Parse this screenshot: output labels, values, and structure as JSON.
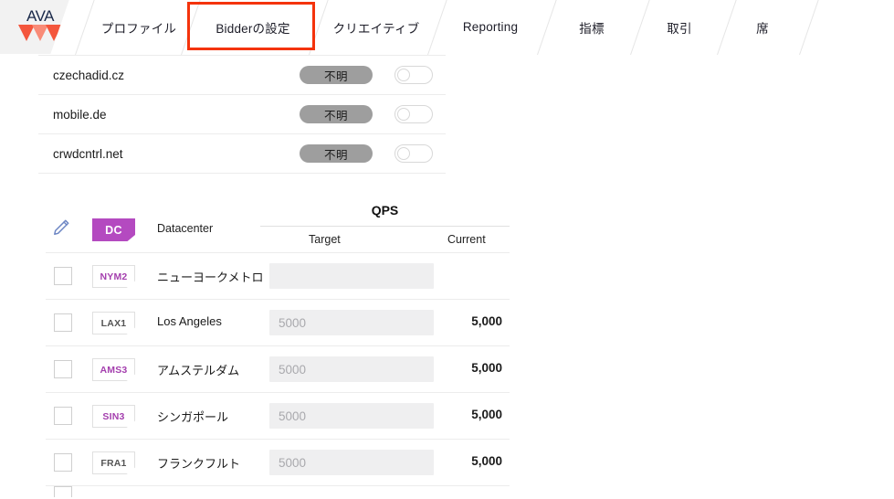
{
  "app": {
    "logo_text": "AVA",
    "logo_icon": "ava-triangles-logo"
  },
  "tabs": [
    {
      "label": "プロファイル",
      "selected": false
    },
    {
      "label": "Bidderの設定",
      "selected": true
    },
    {
      "label": "クリエイティブ",
      "selected": false
    },
    {
      "label": "Reporting",
      "selected": false
    },
    {
      "label": "指標",
      "selected": false
    },
    {
      "label": "取引",
      "selected": false
    },
    {
      "label": "席",
      "selected": false
    }
  ],
  "domain_list": [
    {
      "name": "czechadid.cz",
      "status_badge": "不明",
      "toggle": "off"
    },
    {
      "name": "mobile.de",
      "status_badge": "不明",
      "toggle": "off"
    },
    {
      "name": "crwdcntrl.net",
      "status_badge": "不明",
      "toggle": "off"
    }
  ],
  "qps_table": {
    "edit_icon": "pencil-icon",
    "dc_tag": "DC",
    "datacenter_header": "Datacenter",
    "group_header": "QPS",
    "target_header": "Target",
    "current_header": "Current",
    "rows": [
      {
        "code": "NYM2",
        "name": "ニューヨークメトロ",
        "target_value": "",
        "target_placeholder": "",
        "current": ""
      },
      {
        "code": "LAX1",
        "name": "Los Angeles",
        "target_value": "",
        "target_placeholder": "5000",
        "current": "5,000"
      },
      {
        "code": "AMS3",
        "name": "アムステルダム",
        "target_value": "",
        "target_placeholder": "5000",
        "current": "5,000"
      },
      {
        "code": "SIN3",
        "name": "シンガポール",
        "target_value": "",
        "target_placeholder": "5000",
        "current": "5,000"
      },
      {
        "code": "FRA1",
        "name": "フランクフルト",
        "target_value": "",
        "target_placeholder": "5000",
        "current": "5,000"
      }
    ]
  },
  "annotation": {
    "type": "highlight-rectangle",
    "color": "#f4330c",
    "targets_tab": "Bidderの設定"
  },
  "colors": {
    "accent_purple": "#b44ac0",
    "logo_red": "#f4563c",
    "logo_red_light": "#f98b77",
    "badge_gray": "#9e9e9e",
    "annotation_red": "#f4330c"
  }
}
